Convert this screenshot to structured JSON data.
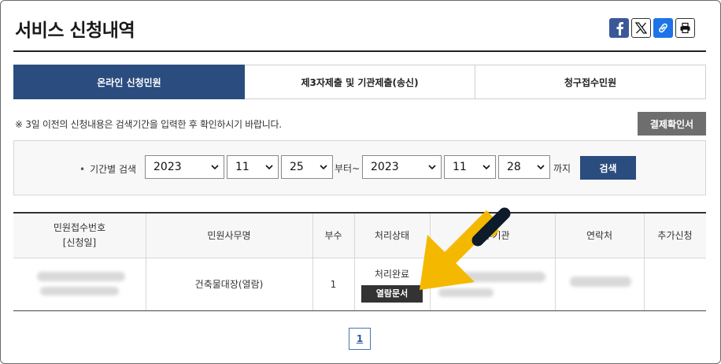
{
  "page": {
    "title": "서비스 신청내역"
  },
  "share": {
    "facebook_icon": "facebook-icon",
    "x_icon": "x-icon",
    "link_icon": "link-icon",
    "print_icon": "print-icon"
  },
  "tabs": [
    {
      "label": "온라인 신청민원",
      "active": true
    },
    {
      "label": "제3자제출 및 기관제출(송신)",
      "active": false
    },
    {
      "label": "청구접수민원",
      "active": false
    }
  ],
  "notice": "※ 3일 이전의 신청내용은 검색기간을 입력한 후 확인하시기 바랍니다.",
  "receipt_button": "결제확인서",
  "search": {
    "label": "기간별 검색",
    "from": {
      "year": "2023",
      "month": "11",
      "day": "25"
    },
    "from_suffix": "부터~",
    "to": {
      "year": "2023",
      "month": "11",
      "day": "28"
    },
    "to_suffix": "까지",
    "button": "검색"
  },
  "table": {
    "headers": {
      "receipt_no": "민원접수번호",
      "apply_date": "[신청일]",
      "service": "민원사무명",
      "copies": "부수",
      "status": "처리상태",
      "agency": "교부기관",
      "contact": "연락처",
      "extra": "추가신청"
    },
    "rows": [
      {
        "service": "건축물대장(열람)",
        "copies": "1",
        "status": "처리완료",
        "view_button": "열람문서"
      }
    ]
  },
  "pagination": {
    "current": "1"
  },
  "colors": {
    "primary": "#2b4c7e",
    "arrow": "#f5b800",
    "gray_button": "#6e6e6e"
  }
}
